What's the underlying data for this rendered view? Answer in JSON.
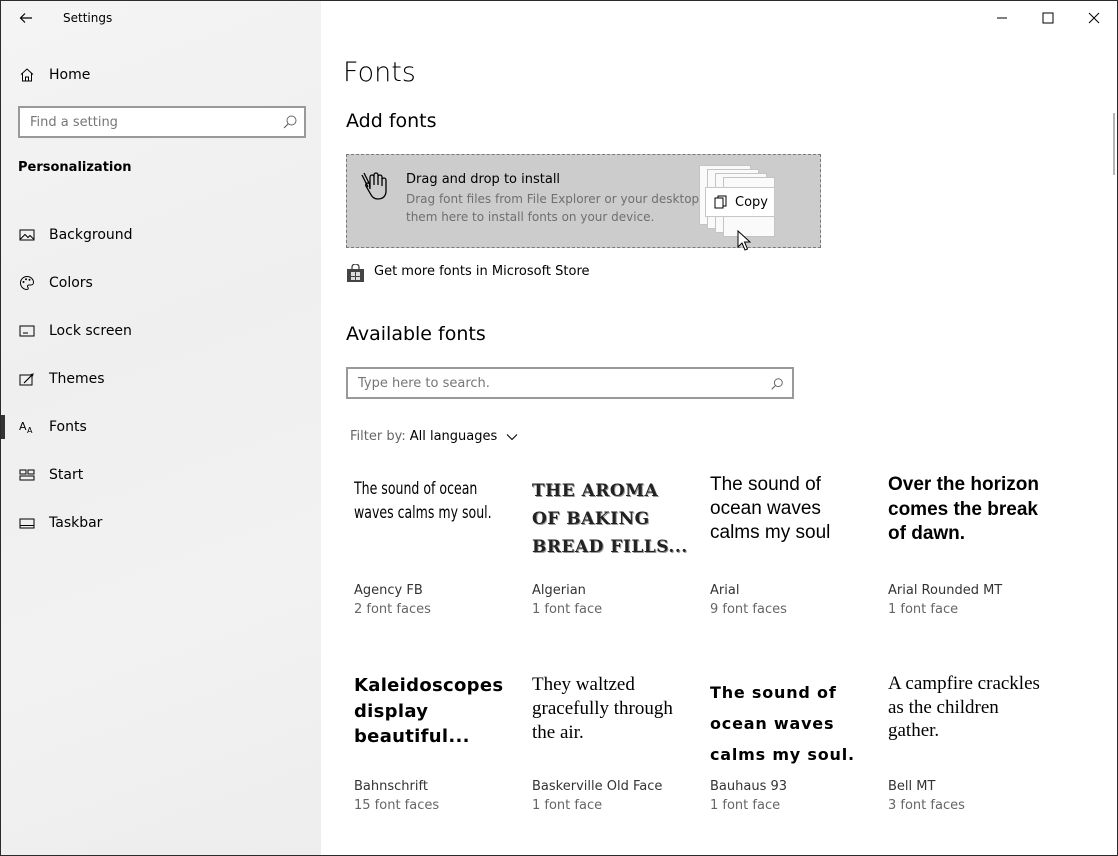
{
  "window": {
    "title": "Settings"
  },
  "sidebar": {
    "home_label": "Home",
    "search_placeholder": "Find a setting",
    "section_title": "Personalization",
    "items": [
      {
        "label": "Background",
        "icon": "image-icon"
      },
      {
        "label": "Colors",
        "icon": "palette-icon"
      },
      {
        "label": "Lock screen",
        "icon": "lock-screen-icon"
      },
      {
        "label": "Themes",
        "icon": "themes-icon"
      },
      {
        "label": "Fonts",
        "icon": "fonts-icon",
        "active": true
      },
      {
        "label": "Start",
        "icon": "start-icon"
      },
      {
        "label": "Taskbar",
        "icon": "taskbar-icon"
      }
    ]
  },
  "main": {
    "title": "Fonts",
    "add_fonts_heading": "Add fonts",
    "dropzone": {
      "title": "Drag and drop to install",
      "description": "Drag font files from File Explorer or your desktop and drop them here to install fonts on your device.",
      "copy_label": "Copy"
    },
    "store_link": "Get more fonts in Microsoft Store",
    "available_heading": "Available fonts",
    "search_placeholder": "Type here to search.",
    "filter_label": "Filter by:",
    "filter_value": "All languages",
    "fonts": [
      {
        "sample": "The sound of ocean waves calms my soul.",
        "name": "Agency FB",
        "faces": "2 font faces"
      },
      {
        "sample": "THE AROMA OF BAKING BREAD FILLS...",
        "name": "Algerian",
        "faces": "1 font face"
      },
      {
        "sample": "The sound of ocean waves calms my soul",
        "name": "Arial",
        "faces": "9 font faces"
      },
      {
        "sample": "Over the horizon comes the break of dawn.",
        "name": "Arial Rounded MT",
        "faces": "1 font face"
      },
      {
        "sample": "Kaleidoscopes display beautiful...",
        "name": "Bahnschrift",
        "faces": "15 font faces"
      },
      {
        "sample": "They waltzed gracefully through the air.",
        "name": "Baskerville Old Face",
        "faces": "1 font face"
      },
      {
        "sample": "The sound of ocean waves calms my soul.",
        "name": "Bauhaus 93",
        "faces": "1 font face"
      },
      {
        "sample": "A campfire crackles as the children gather.",
        "name": "Bell MT",
        "faces": "3 font faces"
      }
    ]
  }
}
